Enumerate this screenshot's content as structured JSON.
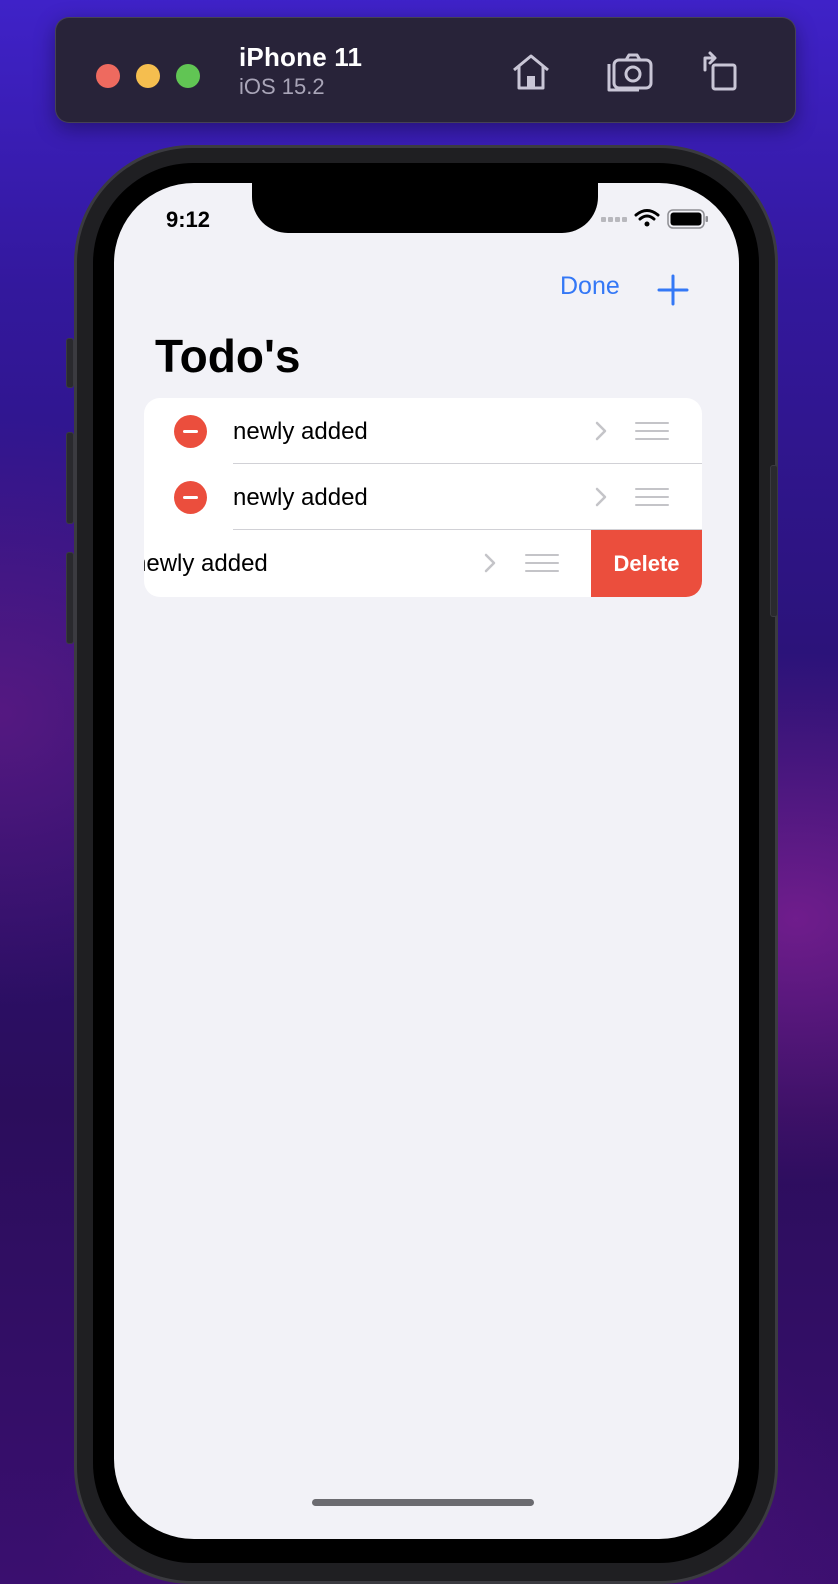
{
  "toolbar": {
    "device_name": "iPhone 11",
    "os_version": "iOS 15.2",
    "icons": [
      "home-icon",
      "screenshot-icon",
      "rotate-icon"
    ]
  },
  "status_bar": {
    "time": "9:12",
    "icons": [
      "cellular-icon",
      "wifi-icon",
      "battery-icon"
    ]
  },
  "nav": {
    "done_label": "Done",
    "add_icon": "plus-icon"
  },
  "page": {
    "title": "Todo's"
  },
  "todos": [
    {
      "label": "newly added",
      "mode": "editing"
    },
    {
      "label": "newly added",
      "mode": "editing"
    },
    {
      "label": "newly added",
      "mode": "swiped"
    }
  ],
  "swipe_action": {
    "label": "Delete"
  },
  "colors": {
    "accent": "#3478f6",
    "destructive": "#eb4e3d",
    "background": "#f2f2f7"
  }
}
